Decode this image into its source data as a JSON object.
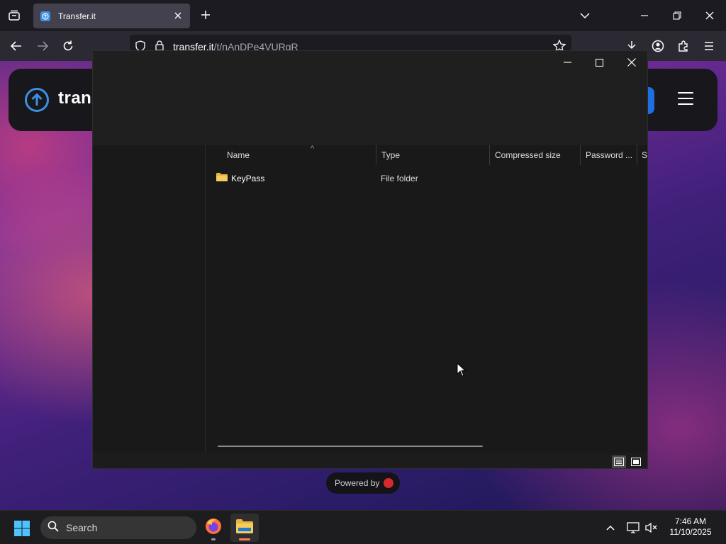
{
  "browser": {
    "tab": {
      "title": "Transfer.it"
    },
    "address": {
      "host": "transfer.it",
      "path": "/t/nAnDPe4VURgR"
    }
  },
  "page": {
    "logo_text": "trans",
    "powered_by": "Powered by"
  },
  "explorer": {
    "columns": [
      "Name",
      "Type",
      "Compressed size",
      "Password ...",
      "Si"
    ],
    "sort_indicator": "^",
    "rows": [
      {
        "name": "KeyPass",
        "type": "File folder"
      }
    ]
  },
  "taskbar": {
    "search_label": "Search",
    "time": "7:46 AM",
    "date": "11/10/2025"
  },
  "colors": {
    "accent_blue": "#3c8fe4",
    "folder_yellow": "#f2c14e",
    "firefox_orange": "#ff7139"
  }
}
